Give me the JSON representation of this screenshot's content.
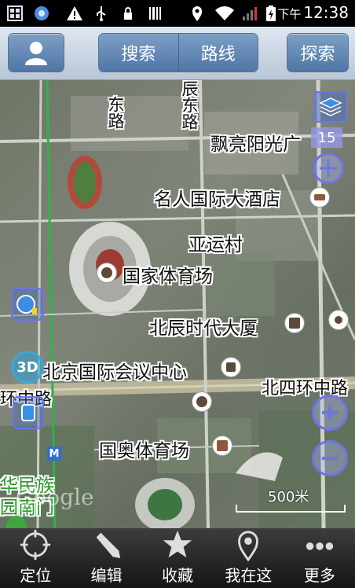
{
  "status_bar": {
    "time_prefix": "下午",
    "time": "12:38",
    "icons": [
      "grid-icon",
      "browser-icon",
      "warning-icon",
      "usb-icon",
      "lock-icon",
      "barcode-icon",
      "location-icon",
      "wifi-icon",
      "signal-icon",
      "battery-charging-icon"
    ]
  },
  "topbar": {
    "user_icon": "user-icon",
    "search_label": "搜索",
    "route_label": "路线",
    "explore_label": "探索"
  },
  "map": {
    "labels": {
      "road_1": "东路",
      "road_2": "辰东路",
      "piaoliang": "飘亮阳光广",
      "hotel": "名人国际大酒店",
      "yayuncun": "亚运村",
      "stadium": "国家体育场",
      "beichen": "北辰时代大厦",
      "conference": "北京国际会议中心",
      "ring_left": "环中路",
      "ring_right": "北四环中路",
      "aoti": "国奥体育场",
      "huaminzu": "华民族",
      "nanmen": "园南门"
    },
    "controls": {
      "layers_icon": "layers-icon",
      "zoom_level": "15",
      "compass_icon": "compass-icon",
      "satellite_icon": "satellite-icon",
      "mode_3d": "3D",
      "traffic_icon": "traffic-icon",
      "zoom_in_icon": "zoom-in-icon",
      "zoom_out_icon": "zoom-out-icon",
      "metro_badge": "M"
    },
    "scale": "500米",
    "watermark": "Google"
  },
  "bottombar": {
    "items": [
      {
        "label": "定位",
        "icon": "locate-icon"
      },
      {
        "label": "编辑",
        "icon": "pencil-icon"
      },
      {
        "label": "收藏",
        "icon": "star-icon"
      },
      {
        "label": "我在这",
        "icon": "pin-icon"
      },
      {
        "label": "更多",
        "icon": "more-icon"
      }
    ]
  }
}
